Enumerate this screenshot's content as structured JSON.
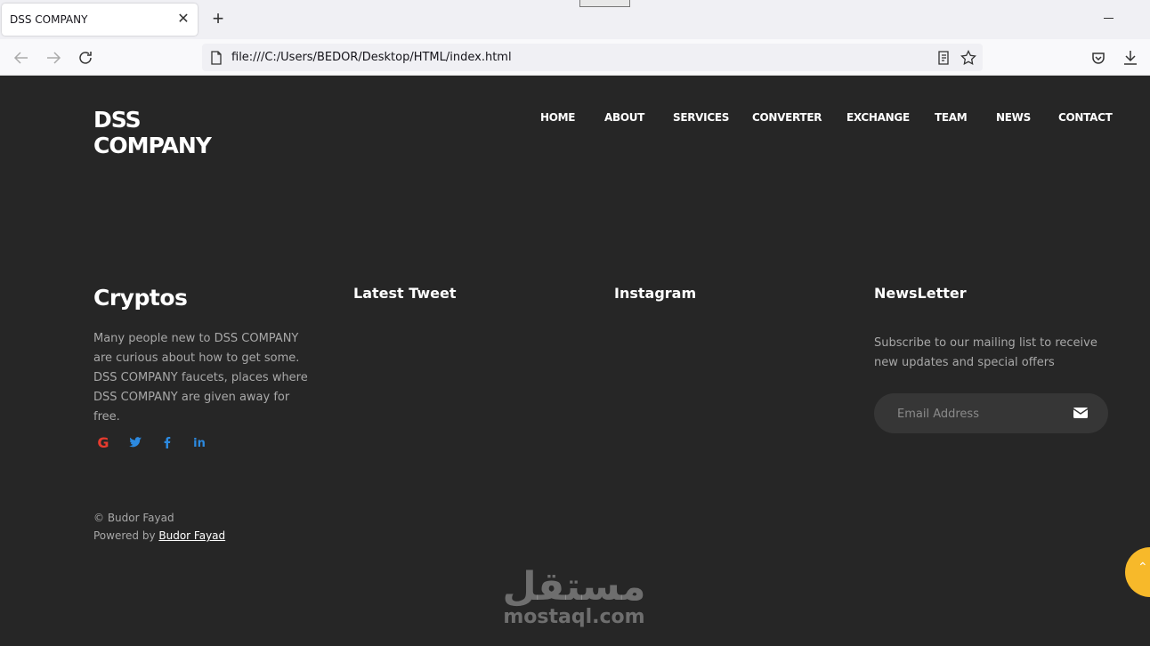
{
  "browser": {
    "tab_title": "DSS COMPANY",
    "url": "file:///C:/Users/BEDOR/Desktop/HTML/index.html",
    "icons": [
      "back-icon",
      "forward-icon",
      "reload-icon",
      "page-icon",
      "reader-view-icon",
      "bookmark-star-icon",
      "pocket-icon",
      "download-icon",
      "close-icon",
      "plus-icon",
      "minimize-icon"
    ]
  },
  "header": {
    "logo_line1": "DSS",
    "logo_line2": "COMPANY",
    "menu": [
      "HOME",
      "ABOUT",
      "SERVICES",
      "CONVERTER",
      "EXCHANGE",
      "TEAM",
      "NEWS",
      "CONTACT"
    ]
  },
  "footer": {
    "about": {
      "title": "Cryptos",
      "text": "Many people new to DSS COMPANY are curious about how to get some. DSS COMPANY faucets, places where DSS COMPANY are given away for free.",
      "social_icons": [
        "google-icon",
        "twitter-icon",
        "facebook-icon",
        "linkedin-icon"
      ]
    },
    "tweets": {
      "title": "Latest Tweet"
    },
    "instagram": {
      "title": "Instagram"
    },
    "newsletter": {
      "title": "NewsLetter",
      "text": "Subscribe to our mailing list to receive new updates and special offers",
      "email_placeholder": "Email Address"
    },
    "copyright": "© Budor Fayad",
    "powered_prefix": "Powered by ",
    "powered_link": "Budor Fayad "
  },
  "watermark": {
    "arabic": "مستقل",
    "latin": "mostaql.com"
  },
  "colors": {
    "background": "#262626",
    "accent_yellow": "#f7b92a",
    "google_red": "#e63b2e",
    "social_blue": "#2c8ae0"
  }
}
